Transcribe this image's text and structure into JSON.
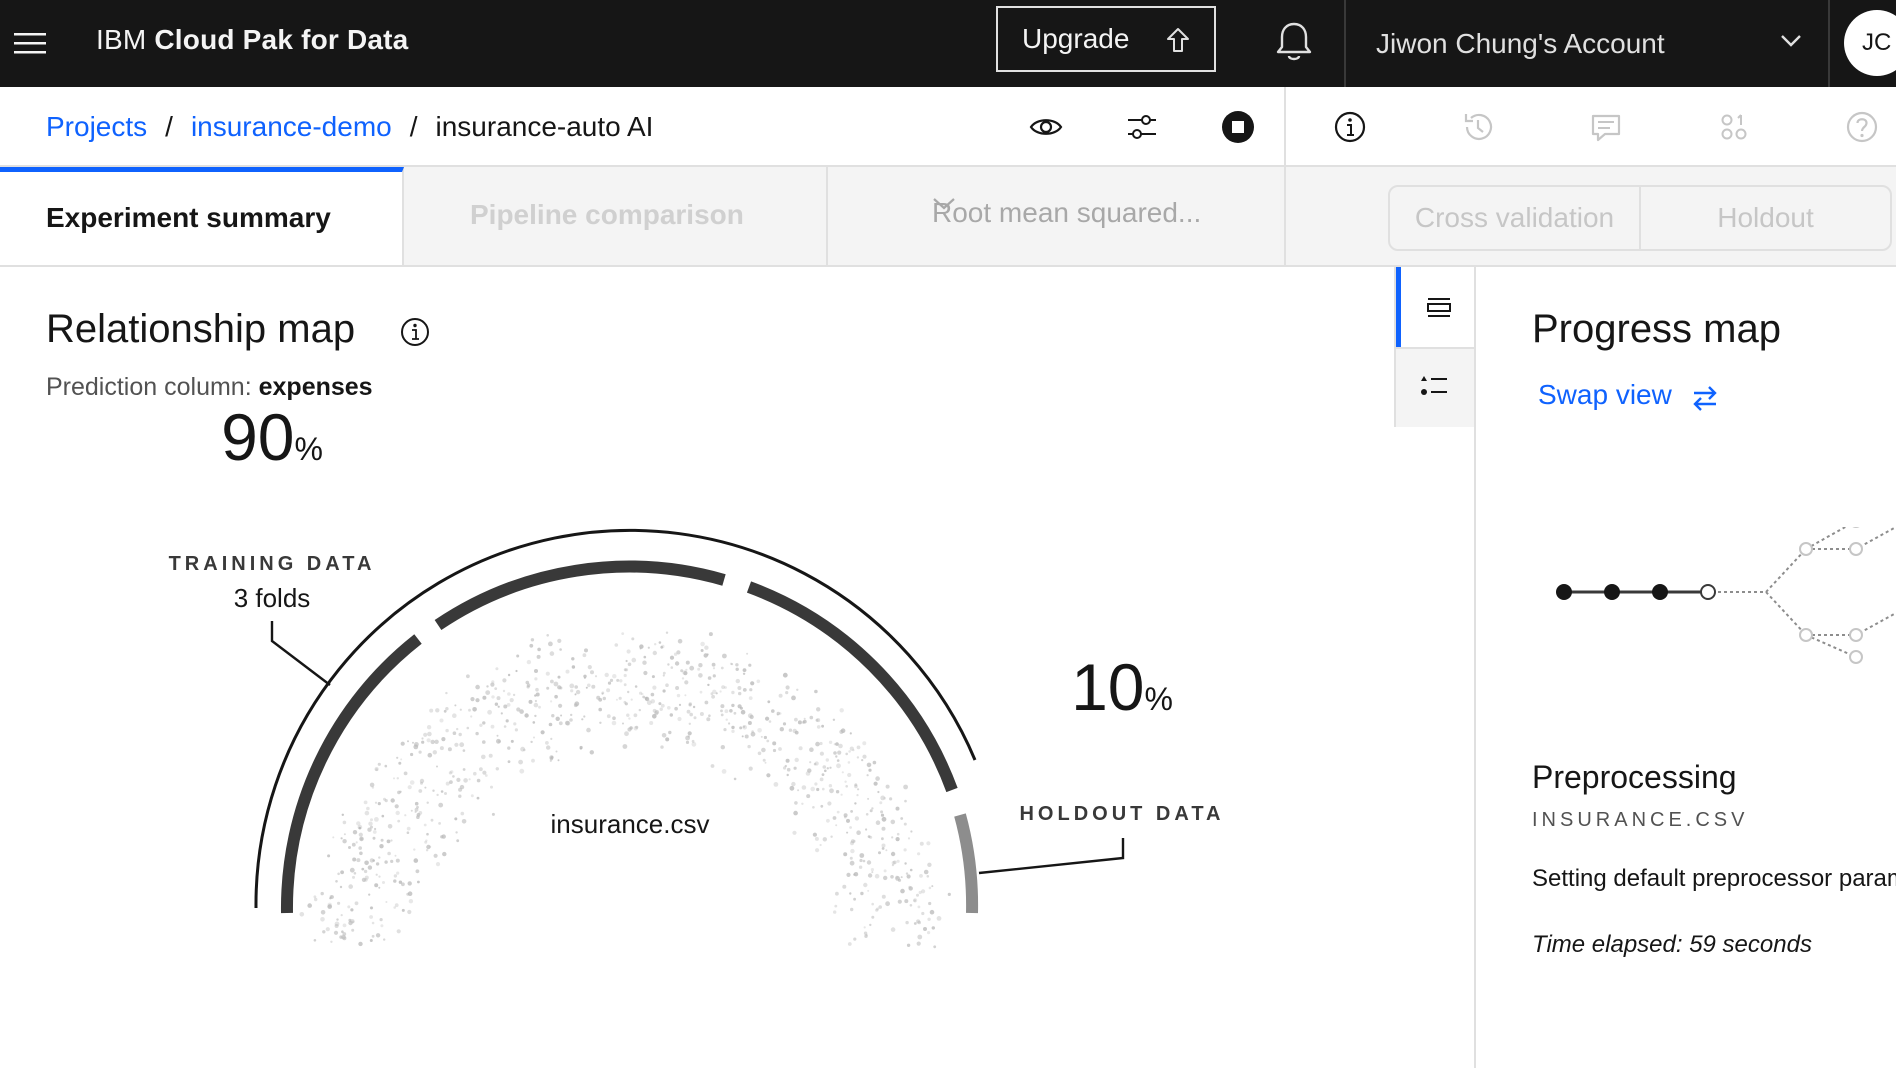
{
  "topbar": {
    "brand_prefix": "IBM",
    "brand_name": "Cloud Pak for Data",
    "upgrade_label": "Upgrade",
    "account_name": "Jiwon Chung's Account",
    "avatar_initials": "JC",
    "icons": [
      "menu-icon",
      "upload-icon",
      "notification-bell-icon",
      "chevron-down-icon"
    ]
  },
  "breadcrumb": {
    "items": [
      {
        "label": "Projects",
        "link": true
      },
      {
        "label": "insurance-demo",
        "link": true
      },
      {
        "label": "insurance-auto AI",
        "link": false
      }
    ],
    "separator": "/",
    "actions": [
      "view-icon",
      "settings-sliders-icon",
      "stop-icon",
      "info-icon",
      "history-icon",
      "comment-icon",
      "apps-icon",
      "help-icon"
    ]
  },
  "tabs": {
    "active": "Experiment summary",
    "inactive": "Pipeline comparison",
    "metric_dropdown": "Root mean squared...",
    "segments": [
      "Cross validation",
      "Holdout"
    ]
  },
  "relationship_map": {
    "title": "Relationship map",
    "prediction_label": "Prediction column:",
    "prediction_value": "expenses",
    "training_pct": "90",
    "training_pct_symbol": "%",
    "training_label": "TRAINING DATA",
    "training_folds": "3 folds",
    "holdout_pct": "10",
    "holdout_pct_symbol": "%",
    "holdout_label": "HOLDOUT DATA",
    "dataset": "insurance.csv"
  },
  "progress_map": {
    "title": "Progress map",
    "swap_label": "Swap view",
    "stage_title": "Preprocessing",
    "stage_file": "INSURANCE.CSV",
    "stage_message": "Setting default preprocessor parameters",
    "time_elapsed": "Time elapsed: 59 seconds",
    "completed_steps": 3
  },
  "colors": {
    "topbar_bg": "#161616",
    "link_blue": "#0f62fe",
    "arc_dark": "#393939",
    "arc_holdout": "#8d8d8d"
  }
}
